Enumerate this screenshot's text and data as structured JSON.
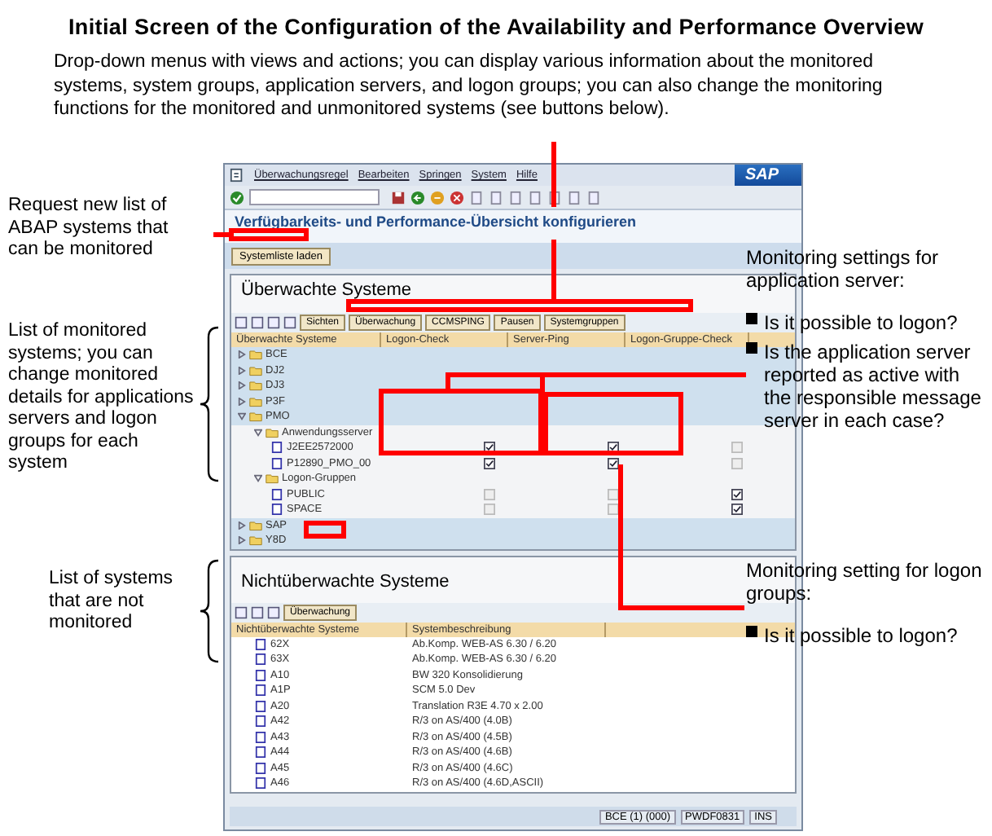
{
  "title": "Initial Screen of the Configuration of the Availability and Performance Overview",
  "description": "Drop-down menus with views and actions; you can display various information about the monitored systems, system groups, application servers, and logon groups; you can also change the monitoring functions for the monitored and unmonitored systems (see buttons below).",
  "left_notes": [
    {
      "text": "Request new list of ABAP systems that can be monitored"
    },
    {
      "text": "List of monitored systems; you can change monitored details for applications servers and logon groups for each system"
    },
    {
      "text": "List of systems that are not monitored"
    }
  ],
  "right_notes": [
    {
      "heading": "Monitoring settings for application server:",
      "bullets": [
        "Is it possible to logon?",
        "Is the application server reported as active with the responsible message server in each case?"
      ]
    },
    {
      "heading": "Monitoring setting for logon groups:",
      "bullets": [
        "Is it possible to logon?"
      ]
    }
  ],
  "window": {
    "menu": [
      "Überwachungsregel",
      "Bearbeiten",
      "Springen",
      "System",
      "Hilfe"
    ],
    "logo": "SAP",
    "title": "Verfügbarkeits- und Performance-Übersicht konfigurieren",
    "app_button": "Systemliste laden",
    "monitored": {
      "heading": "Überwachte Systeme",
      "buttons": [
        "Sichten",
        "Überwachung",
        "CCMSPING",
        "Pausen",
        "Systemgruppen"
      ],
      "columns": [
        "Überwachte Systeme",
        "Logon-Check",
        "Server-Ping",
        "Logon-Gruppe-Check"
      ],
      "tree": [
        {
          "name": "BCE",
          "expanded": false
        },
        {
          "name": "DJ2",
          "expanded": false
        },
        {
          "name": "DJ3",
          "expanded": false
        },
        {
          "name": "P3F",
          "expanded": false
        },
        {
          "name": "PMO",
          "expanded": true,
          "children": [
            {
              "name": "Anwendungsserver",
              "expanded": true,
              "children": [
                {
                  "name": "J2EE2572000",
                  "checks": [
                    {
                      "checked": true
                    },
                    {
                      "checked": true
                    },
                    {
                      "checked": false
                    }
                  ]
                },
                {
                  "name": "P12890_PMO_00",
                  "checks": [
                    {
                      "checked": true
                    },
                    {
                      "checked": true
                    },
                    {
                      "checked": false
                    }
                  ]
                }
              ]
            },
            {
              "name": "Logon-Gruppen",
              "expanded": true,
              "children": [
                {
                  "name": "PUBLIC",
                  "checks": [
                    {
                      "checked": false
                    },
                    {
                      "checked": false
                    },
                    {
                      "checked": true
                    }
                  ]
                },
                {
                  "name": "SPACE",
                  "checks": [
                    {
                      "checked": false
                    },
                    {
                      "checked": false
                    },
                    {
                      "checked": true
                    }
                  ]
                }
              ]
            }
          ]
        },
        {
          "name": "SAP",
          "expanded": false
        },
        {
          "name": "Y8D",
          "expanded": false
        }
      ]
    },
    "unmonitored": {
      "heading": "Nichtüberwachte Systeme",
      "buttons": [
        "Überwachung"
      ],
      "columns": [
        "Nichtüberwachte Systeme",
        "Systembeschreibung"
      ],
      "rows": [
        {
          "name": "62X",
          "description": "Ab.Komp. WEB-AS 6.30 / 6.20"
        },
        {
          "name": "63X",
          "description": "Ab.Komp. WEB-AS 6.30 / 6.20"
        },
        {
          "name": "A10",
          "description": "BW 320 Konsolidierung"
        },
        {
          "name": "A1P",
          "description": "SCM 5.0 Dev"
        },
        {
          "name": "A20",
          "description": "Translation R3E 4.70 x 2.00"
        },
        {
          "name": "A42",
          "description": "R/3 on AS/400 (4.0B)"
        },
        {
          "name": "A43",
          "description": "R/3 on AS/400 (4.5B)"
        },
        {
          "name": "A44",
          "description": "R/3 on AS/400 (4.6B)"
        },
        {
          "name": "A45",
          "description": "R/3 on AS/400 (4.6C)"
        },
        {
          "name": "A46",
          "description": "R/3 on AS/400 (4.6D,ASCII)"
        }
      ]
    },
    "status": [
      "BCE (1) (000)",
      "PWDF0831",
      "INS"
    ]
  }
}
